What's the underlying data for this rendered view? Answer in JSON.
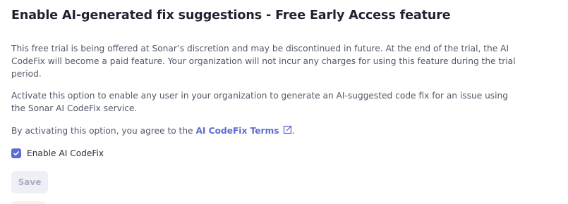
{
  "page": {
    "title": "Enable AI-generated fix suggestions - Free Early Access feature"
  },
  "content": {
    "paragraph_trial": "This free trial is being offered at Sonar’s discretion and may be discontinued in future. At the end of the trial, the AI CodeFix will become a paid feature. Your organization will not incur any charges for using this feature during the trial period.",
    "paragraph_activate": "Activate this option to enable any user in your organization to generate an AI-suggested code fix for an issue using the Sonar AI CodeFix service.",
    "agree_prefix": "By activating this option, you agree to the ",
    "terms_link": "AI CodeFix Terms",
    "agree_suffix": "."
  },
  "option": {
    "label": "Enable AI CodeFix",
    "checked": true
  },
  "actions": {
    "save_label": "Save",
    "save_enabled": false
  },
  "icons": {
    "external_link": "external-link-icon",
    "check": "check-icon"
  },
  "colors": {
    "accent": "#5d6cd0",
    "title": "#1e2231",
    "body_text": "#525869",
    "disabled_button_bg": "#eef0f6",
    "disabled_button_text": "#a9afc2"
  }
}
